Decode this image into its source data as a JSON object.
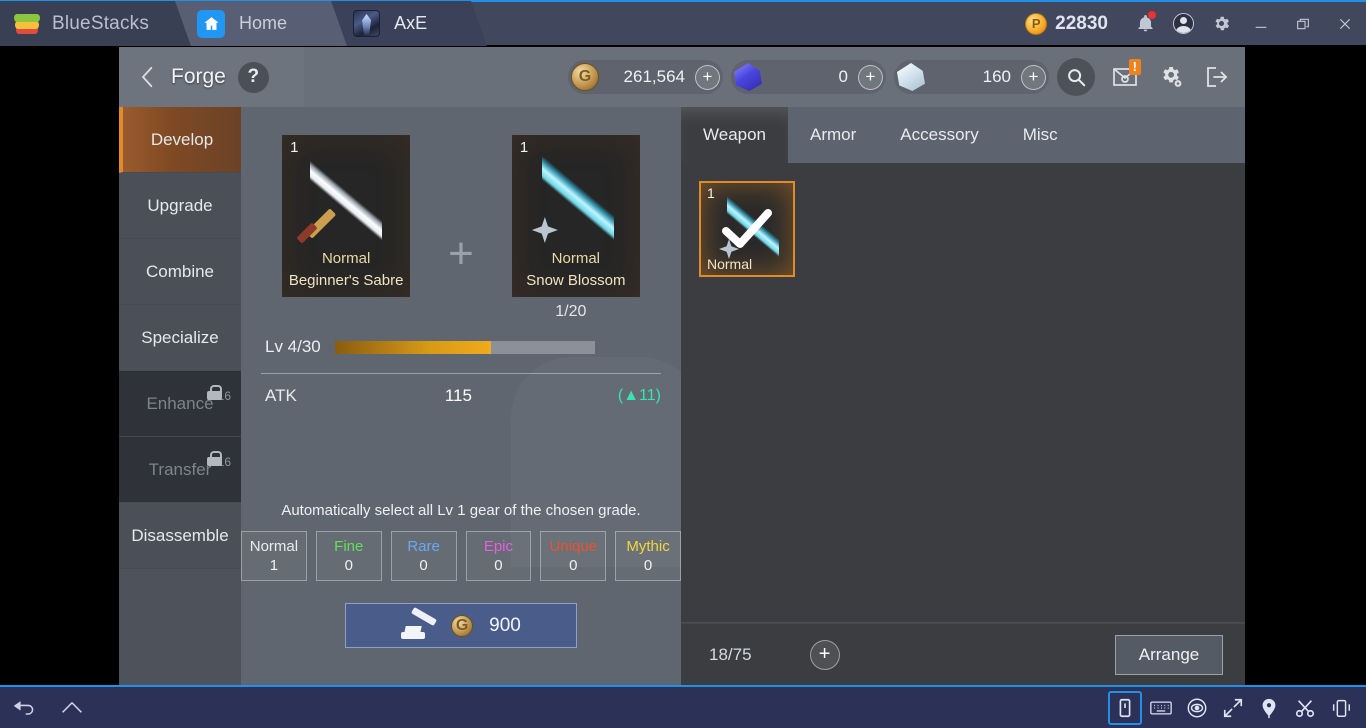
{
  "titlebar": {
    "brand": "BlueStacks",
    "tabs": [
      {
        "label": "Home",
        "icon": "home-icon"
      },
      {
        "label": "AxE",
        "icon": "game-app-icon"
      }
    ],
    "points": "22830",
    "points_icon": "bluestacks-points-coin-icon",
    "icons": [
      "notification-bell-icon",
      "account-avatar-icon",
      "settings-gear-icon"
    ],
    "window_controls": [
      "minimize",
      "restore",
      "close"
    ]
  },
  "game": {
    "header": {
      "back": "back-chevron-icon",
      "title": "Forge",
      "help": "?",
      "currencies": [
        {
          "name": "gold",
          "icon": "gold-coin-icon",
          "value": "261,564",
          "add": "+"
        },
        {
          "name": "blue-gem",
          "icon": "blue-gem-icon",
          "value": "0",
          "add": "+"
        },
        {
          "name": "white-gem",
          "icon": "white-gem-icon",
          "value": "160",
          "add": "+"
        }
      ],
      "actions": [
        "search-icon",
        "mail-inbox-icon",
        "settings-gears-icon",
        "exit-icon"
      ],
      "mail_badge": "!"
    },
    "sidebar": [
      {
        "label": "Develop",
        "active": true,
        "locked": false
      },
      {
        "label": "Upgrade",
        "active": false,
        "locked": false
      },
      {
        "label": "Combine",
        "active": false,
        "locked": false
      },
      {
        "label": "Specialize",
        "active": false,
        "locked": false
      },
      {
        "label": "Enhance",
        "active": false,
        "locked": true,
        "lock_level": "2-16"
      },
      {
        "label": "Transfer",
        "active": false,
        "locked": true,
        "lock_level": "2-16"
      },
      {
        "label": "Disassemble",
        "active": false,
        "locked": false
      }
    ],
    "craft": {
      "base_item": {
        "qty": "1",
        "grade": "Normal",
        "name": "Beginner's Sabre"
      },
      "material_item": {
        "qty": "1",
        "grade": "Normal",
        "name": "Snow Blossom"
      },
      "joiner": "+",
      "material_count": "1/20",
      "level_label": "Lv 4/30",
      "level_progress_pct": 60,
      "stat": {
        "key": "ATK",
        "value": "115",
        "delta": "(▲11)"
      },
      "auto_note": "Automatically select all Lv 1 gear of the chosen grade.",
      "grades": [
        {
          "name": "Normal",
          "count": "1",
          "color": "#e9ecf0"
        },
        {
          "name": "Fine",
          "count": "0",
          "color": "#63e05a"
        },
        {
          "name": "Rare",
          "count": "0",
          "color": "#6aa8f5"
        },
        {
          "name": "Epic",
          "count": "0",
          "color": "#e85fe0"
        },
        {
          "name": "Unique",
          "count": "0",
          "color": "#f04a28"
        },
        {
          "name": "Mythic",
          "count": "0",
          "color": "#f2d636"
        }
      ],
      "forge_button": {
        "icon": "anvil-hammer-icon",
        "cost_icon": "gold-coin-icon",
        "cost": "900"
      }
    },
    "inventory": {
      "tabs": [
        {
          "label": "Weapon",
          "active": true
        },
        {
          "label": "Armor",
          "active": false
        },
        {
          "label": "Accessory",
          "active": false
        },
        {
          "label": "Misc",
          "active": false
        }
      ],
      "items": [
        {
          "qty": "1",
          "grade": "Normal",
          "selected": true,
          "icon": "check-icon"
        }
      ],
      "capacity": "18/75",
      "add": "+",
      "arrange_label": "Arrange"
    }
  },
  "bottombar": {
    "nav": [
      "back-arrow-icon",
      "home-icon"
    ],
    "tools": [
      "rotate-device-icon",
      "keyboard-icon",
      "eye-macro-icon",
      "fullscreen-icon",
      "location-pin-icon",
      "scissors-screenshot-icon",
      "shake-device-icon"
    ]
  },
  "colors": {
    "accent_blue": "#2090e8",
    "active_orange": "#e08b28",
    "stat_up_green": "#2fe3b0"
  }
}
